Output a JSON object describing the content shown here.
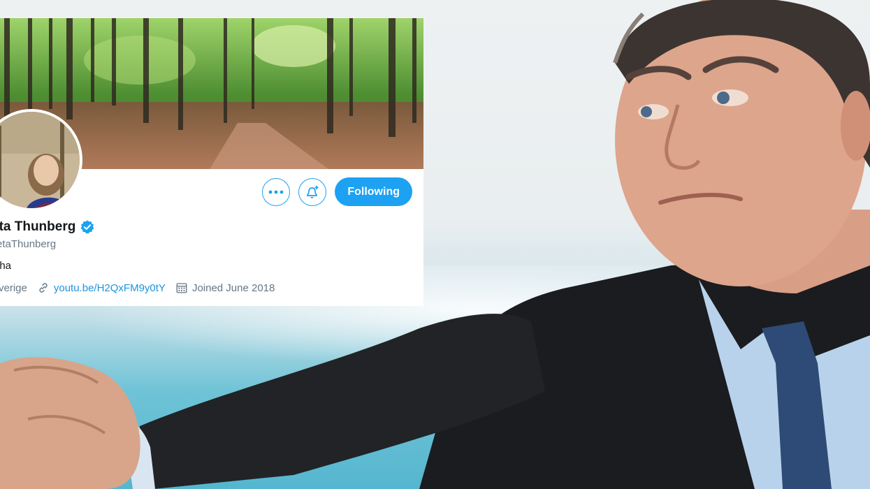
{
  "profile": {
    "display_name": "eta Thunberg",
    "handle": "retaThunberg",
    "bio": "lha",
    "location": "Sverige",
    "website": "youtu.be/H2QxFM9y0tY",
    "joined": "Joined June 2018",
    "verified": true
  },
  "actions": {
    "more_icon": "more-dots-icon",
    "notify_icon": "bell-plus-icon",
    "follow_label": "Following"
  },
  "colors": {
    "accent": "#1da1f2",
    "link": "#1b95e0",
    "muted": "#657786",
    "text": "#14171a"
  }
}
